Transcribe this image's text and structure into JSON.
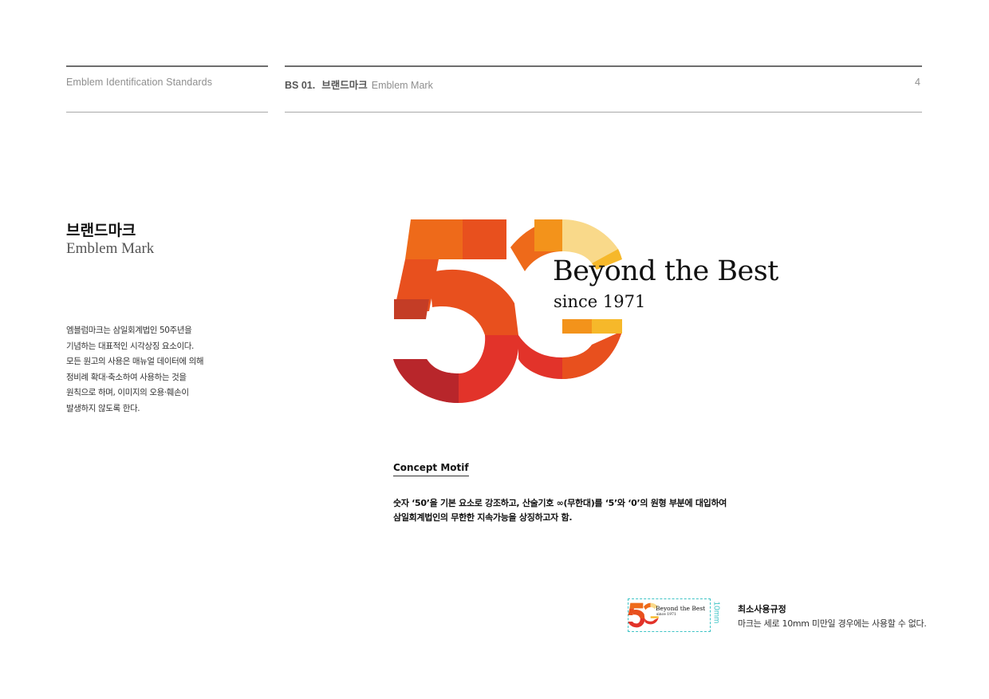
{
  "header": {
    "left_title": "Emblem Identification Standards",
    "section_code": "BS 01.",
    "section_ko": "브랜드마크",
    "section_en": "Emblem Mark",
    "page_number": "4"
  },
  "section": {
    "title_ko": "브랜드마크",
    "title_en": "Emblem Mark",
    "description": [
      "엠블럼마크는 삼일회계법인 50주년을",
      "기념하는 대표적인 시각상징 요소이다.",
      "모든 원고의 사용은 매뉴얼 데이터에 의해",
      "정비례 확대·축소하여 사용하는 것을",
      "원칙으로 하며, 이미지의 오용·훼손이",
      "발생하지 않도록 한다."
    ]
  },
  "emblem": {
    "numeral": "50",
    "tagline": "Beyond the Best",
    "since": "since 1971",
    "colors": {
      "dark_red": "#b8262b",
      "red": "#e2332a",
      "red_orange": "#e8501e",
      "orange": "#ee6a1a",
      "amber": "#f3931b",
      "yellow": "#f6b82a",
      "light_yellow": "#f9d98a"
    }
  },
  "concept": {
    "label": "Concept Motif",
    "lines": [
      "숫자 ‘50’을 기본 요소로 강조하고, 산술기호 ∞(무한대)를 ‘5’와 ‘0’의 원형 부분에 대입하여",
      "삼일회계법인의 무한한 지속가능을 상징하고자 함."
    ]
  },
  "minimum_size": {
    "measure": "10mm",
    "title": "최소사용규정",
    "text": "마크는 세로 10mm 미만일 경우에는 사용할 수 없다."
  }
}
